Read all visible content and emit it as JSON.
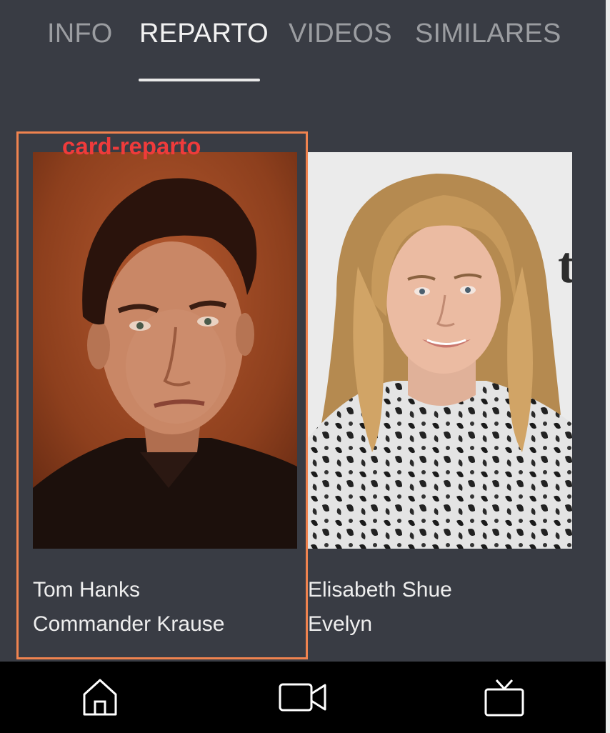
{
  "tabs": [
    {
      "label": "INFO",
      "active": false
    },
    {
      "label": "REPARTO",
      "active": true
    },
    {
      "label": "VIDEOS",
      "active": false
    },
    {
      "label": "SIMILARES",
      "active": false
    }
  ],
  "highlight_label": "card-reparto",
  "cast": [
    {
      "name": "Tom Hanks",
      "character": "Commander Krause"
    },
    {
      "name": "Elisabeth Shue",
      "character": "Evelyn"
    }
  ],
  "bottom_nav": [
    {
      "icon": "home-icon"
    },
    {
      "icon": "video-camera-icon"
    },
    {
      "icon": "tv-icon"
    }
  ],
  "colors": {
    "background": "#393c44",
    "active_tab": "#f2f2f2",
    "inactive_tab": "#9b9da1",
    "highlight_border": "#f0834f",
    "highlight_label": "#ef3b3b",
    "bottom_nav": "#000000"
  }
}
